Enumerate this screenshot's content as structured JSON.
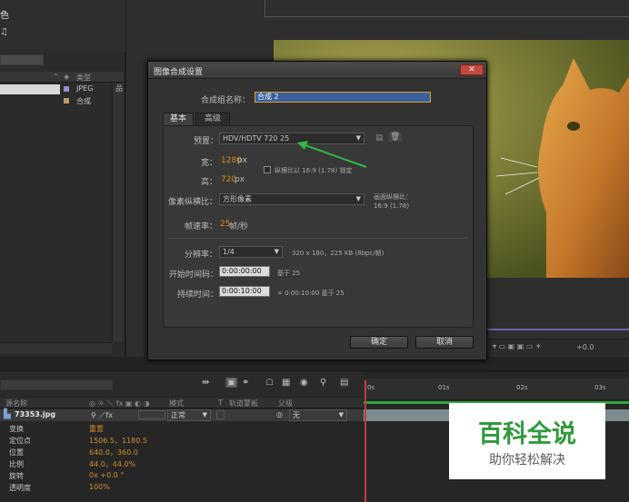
{
  "project": {
    "top_letter": "色",
    "glyph": "♫",
    "column_type": "类型",
    "items": [
      {
        "type": "JPEG",
        "swatch": "#8f8fcc"
      },
      {
        "type": "合成",
        "swatch": "#b59c6a"
      }
    ]
  },
  "dialog": {
    "title": "图像合成设置",
    "name_label": "合成组名称：",
    "name_value": "合成 2",
    "tabs": [
      "基本",
      "高级"
    ],
    "preset_label": "预置：",
    "preset_value": "HDV/HDTV 720 25",
    "width_label": "宽：",
    "width_value": "1280",
    "width_unit": "px",
    "height_label": "高：",
    "height_value": "720",
    "height_unit": "px",
    "lock_label": "纵横比以 16:9 (1.78) 锁定",
    "pixel_aspect_label": "像素纵横比：",
    "pixel_aspect_value": "方形像素",
    "frame_aspect_label": "画面纵横比：",
    "frame_aspect_value": "16:9 (1.78)",
    "framerate_label": "帧速率：",
    "framerate_value": "25",
    "framerate_unit": "帧/秒",
    "resolution_label": "分辨率：",
    "resolution_value": "1/4",
    "resolution_info": "320 x 180，225 KB (8bpc/帧)",
    "start_label": "开始时间码：",
    "start_value": "0:00:00:00",
    "start_base": "基于 25",
    "duration_label": "持续时间：",
    "duration_value": "0:00:10:00",
    "duration_info": "= 0:00:10:00  基于 25",
    "ok_label": "确定",
    "cancel_label": "取消"
  },
  "timeline": {
    "col_name": "源名称",
    "col_mode": "模式",
    "col_t": "T",
    "col_trkmat": "轨道蒙板",
    "col_parent": "父级",
    "layer_name": "73353.jpg",
    "mode_value": "正常",
    "parent_value": "无",
    "props": [
      {
        "name": "变换",
        "value": "重置"
      },
      {
        "name": "定位点",
        "value": "1506.5，1180.5"
      },
      {
        "name": "位置",
        "value": "640.0，360.0"
      },
      {
        "name": "比例",
        "value": "44.0，44.0%"
      },
      {
        "name": "旋转",
        "value": "0x +0.0 °"
      },
      {
        "name": "透明度",
        "value": "100%"
      }
    ],
    "ruler": [
      "0s",
      "01s",
      "02s",
      "03s"
    ]
  },
  "viewer": {
    "zoom_readout": "+0.0"
  },
  "watermark": {
    "title": "百科全说",
    "subtitle": "助你轻松解决"
  }
}
